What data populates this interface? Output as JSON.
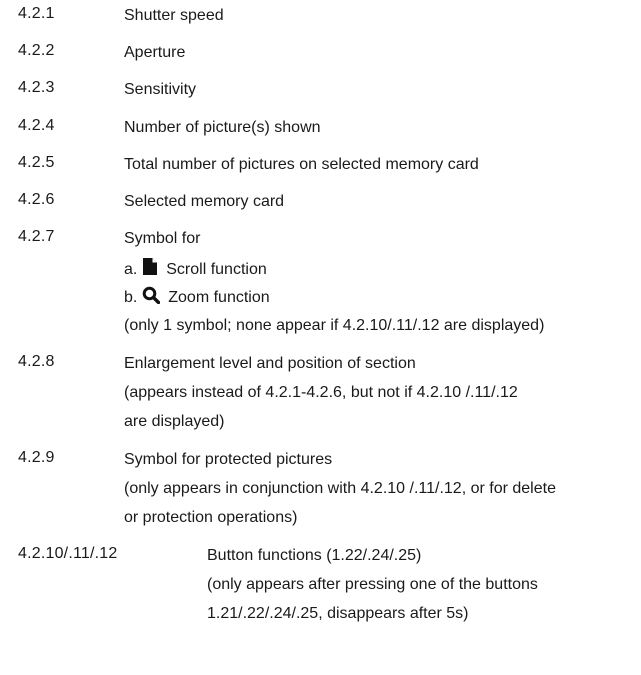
{
  "items": [
    {
      "num": "4.2.1",
      "lines": [
        "Shutter speed"
      ]
    },
    {
      "num": "4.2.2",
      "lines": [
        "Aperture"
      ]
    },
    {
      "num": "4.2.3",
      "lines": [
        "Sensitivity"
      ]
    },
    {
      "num": "4.2.4",
      "lines": [
        "Number of picture(s) shown"
      ]
    },
    {
      "num": "4.2.5",
      "lines": [
        "Total number of pictures on selected memory card"
      ]
    },
    {
      "num": "4.2.6",
      "lines": [
        "Selected memory card"
      ]
    },
    {
      "num": "4.2.7",
      "lines": [
        "Symbol for"
      ],
      "sub": {
        "a_prefix": "a.",
        "a_label": "Scroll function",
        "a_icon": "scroll-document-icon",
        "b_prefix": "b.",
        "b_label": "Zoom function",
        "b_icon": "magnifier-icon",
        "note": "(only 1 symbol; none appear if 4.2.10/.11/.12 are displayed)"
      }
    },
    {
      "num": "4.2.8",
      "lines": [
        "Enlargement level and position of section",
        "(appears instead of 4.2.1-4.2.6, but not if 4.2.10 /.11/.12",
        "are displayed)"
      ]
    },
    {
      "num": "4.2.9",
      "lines": [
        "Symbol for protected pictures",
        "(only appears in conjunction with 4.2.10 /.11/.12, or for delete",
        "or protection operations)"
      ]
    },
    {
      "num": "4.2.10/.11/.12",
      "lines": [
        "Button functions (1.22/.24/.25)",
        "(only appears after pressing one of the buttons",
        "1.21/.22/.24/.25, disappears after 5s)"
      ]
    }
  ]
}
